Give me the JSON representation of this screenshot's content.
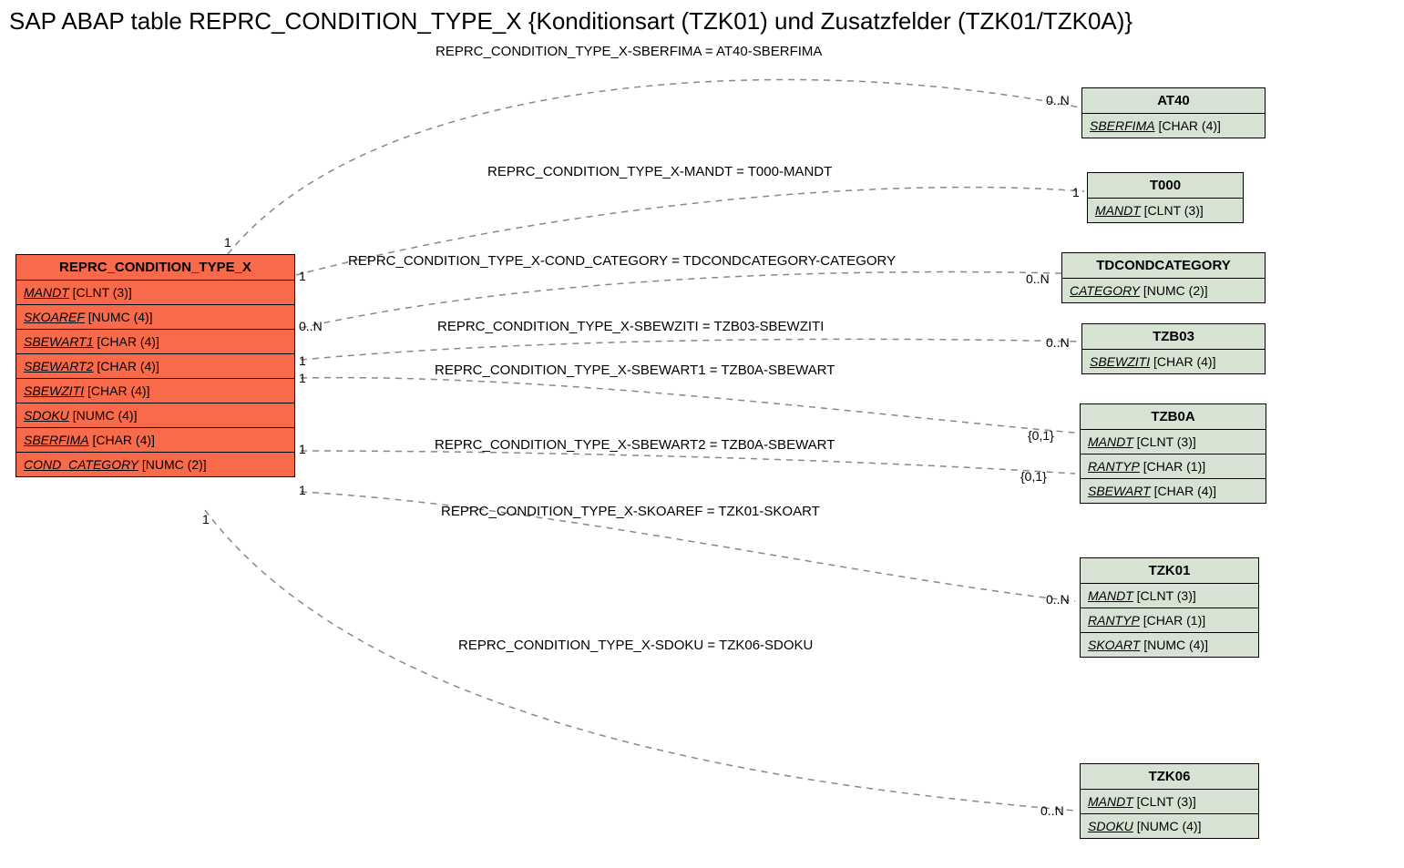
{
  "title": "SAP ABAP table REPRC_CONDITION_TYPE_X {Konditionsart  (TZK01) und Zusatzfelder (TZK01/TZK0A)}",
  "mainEntity": {
    "name": "REPRC_CONDITION_TYPE_X",
    "fields": [
      {
        "name": "MANDT",
        "type": "[CLNT (3)]"
      },
      {
        "name": "SKOAREF",
        "type": "[NUMC (4)]"
      },
      {
        "name": "SBEWART1",
        "type": "[CHAR (4)]"
      },
      {
        "name": "SBEWART2",
        "type": "[CHAR (4)]"
      },
      {
        "name": "SBEWZITI",
        "type": "[CHAR (4)]"
      },
      {
        "name": "SDOKU",
        "type": "[NUMC (4)]"
      },
      {
        "name": "SBERFIMA",
        "type": "[CHAR (4)]"
      },
      {
        "name": "COND_CATEGORY",
        "type": "[NUMC (2)]"
      }
    ]
  },
  "entities": {
    "at40": {
      "name": "AT40",
      "fields": [
        {
          "name": "SBERFIMA",
          "type": "[CHAR (4)]"
        }
      ]
    },
    "t000": {
      "name": "T000",
      "fields": [
        {
          "name": "MANDT",
          "type": "[CLNT (3)]"
        }
      ]
    },
    "tdcond": {
      "name": "TDCONDCATEGORY",
      "fields": [
        {
          "name": "CATEGORY",
          "type": "[NUMC (2)]"
        }
      ]
    },
    "tzb03": {
      "name": "TZB03",
      "fields": [
        {
          "name": "SBEWZITI",
          "type": "[CHAR (4)]"
        }
      ]
    },
    "tzb0a": {
      "name": "TZB0A",
      "fields": [
        {
          "name": "MANDT",
          "type": "[CLNT (3)]"
        },
        {
          "name": "RANTYP",
          "type": "[CHAR (1)]"
        },
        {
          "name": "SBEWART",
          "type": "[CHAR (4)]"
        }
      ]
    },
    "tzk01": {
      "name": "TZK01",
      "fields": [
        {
          "name": "MANDT",
          "type": "[CLNT (3)]"
        },
        {
          "name": "RANTYP",
          "type": "[CHAR (1)]"
        },
        {
          "name": "SKOART",
          "type": "[NUMC (4)]"
        }
      ]
    },
    "tzk06": {
      "name": "TZK06",
      "fields": [
        {
          "name": "MANDT",
          "type": "[CLNT (3)]"
        },
        {
          "name": "SDOKU",
          "type": "[NUMC (4)]"
        }
      ]
    }
  },
  "relations": {
    "r1": "REPRC_CONDITION_TYPE_X-SBERFIMA = AT40-SBERFIMA",
    "r2": "REPRC_CONDITION_TYPE_X-MANDT = T000-MANDT",
    "r3": "REPRC_CONDITION_TYPE_X-COND_CATEGORY = TDCONDCATEGORY-CATEGORY",
    "r4": "REPRC_CONDITION_TYPE_X-SBEWZITI = TZB03-SBEWZITI",
    "r5": "REPRC_CONDITION_TYPE_X-SBEWART1 = TZB0A-SBEWART",
    "r6": "REPRC_CONDITION_TYPE_X-SBEWART2 = TZB0A-SBEWART",
    "r7": "REPRC_CONDITION_TYPE_X-SKOAREF = TZK01-SKOART",
    "r8": "REPRC_CONDITION_TYPE_X-SDOKU = TZK06-SDOKU"
  },
  "cards": {
    "c_main_1a": "1",
    "c_main_1b": "1",
    "c_main_0n": "0..N",
    "c_main_1c": "1",
    "c_main_1d": "1",
    "c_main_1e": "1",
    "c_main_1f": "1",
    "c_main_1g": "1",
    "c_at40": "0..N",
    "c_t000": "1",
    "c_tdcond": "0..N",
    "c_tzb03": "0..N",
    "c_tzb0a_1": "{0,1}",
    "c_tzb0a_2": "{0,1}",
    "c_tzk01": "0..N",
    "c_tzk06": "0..N"
  }
}
